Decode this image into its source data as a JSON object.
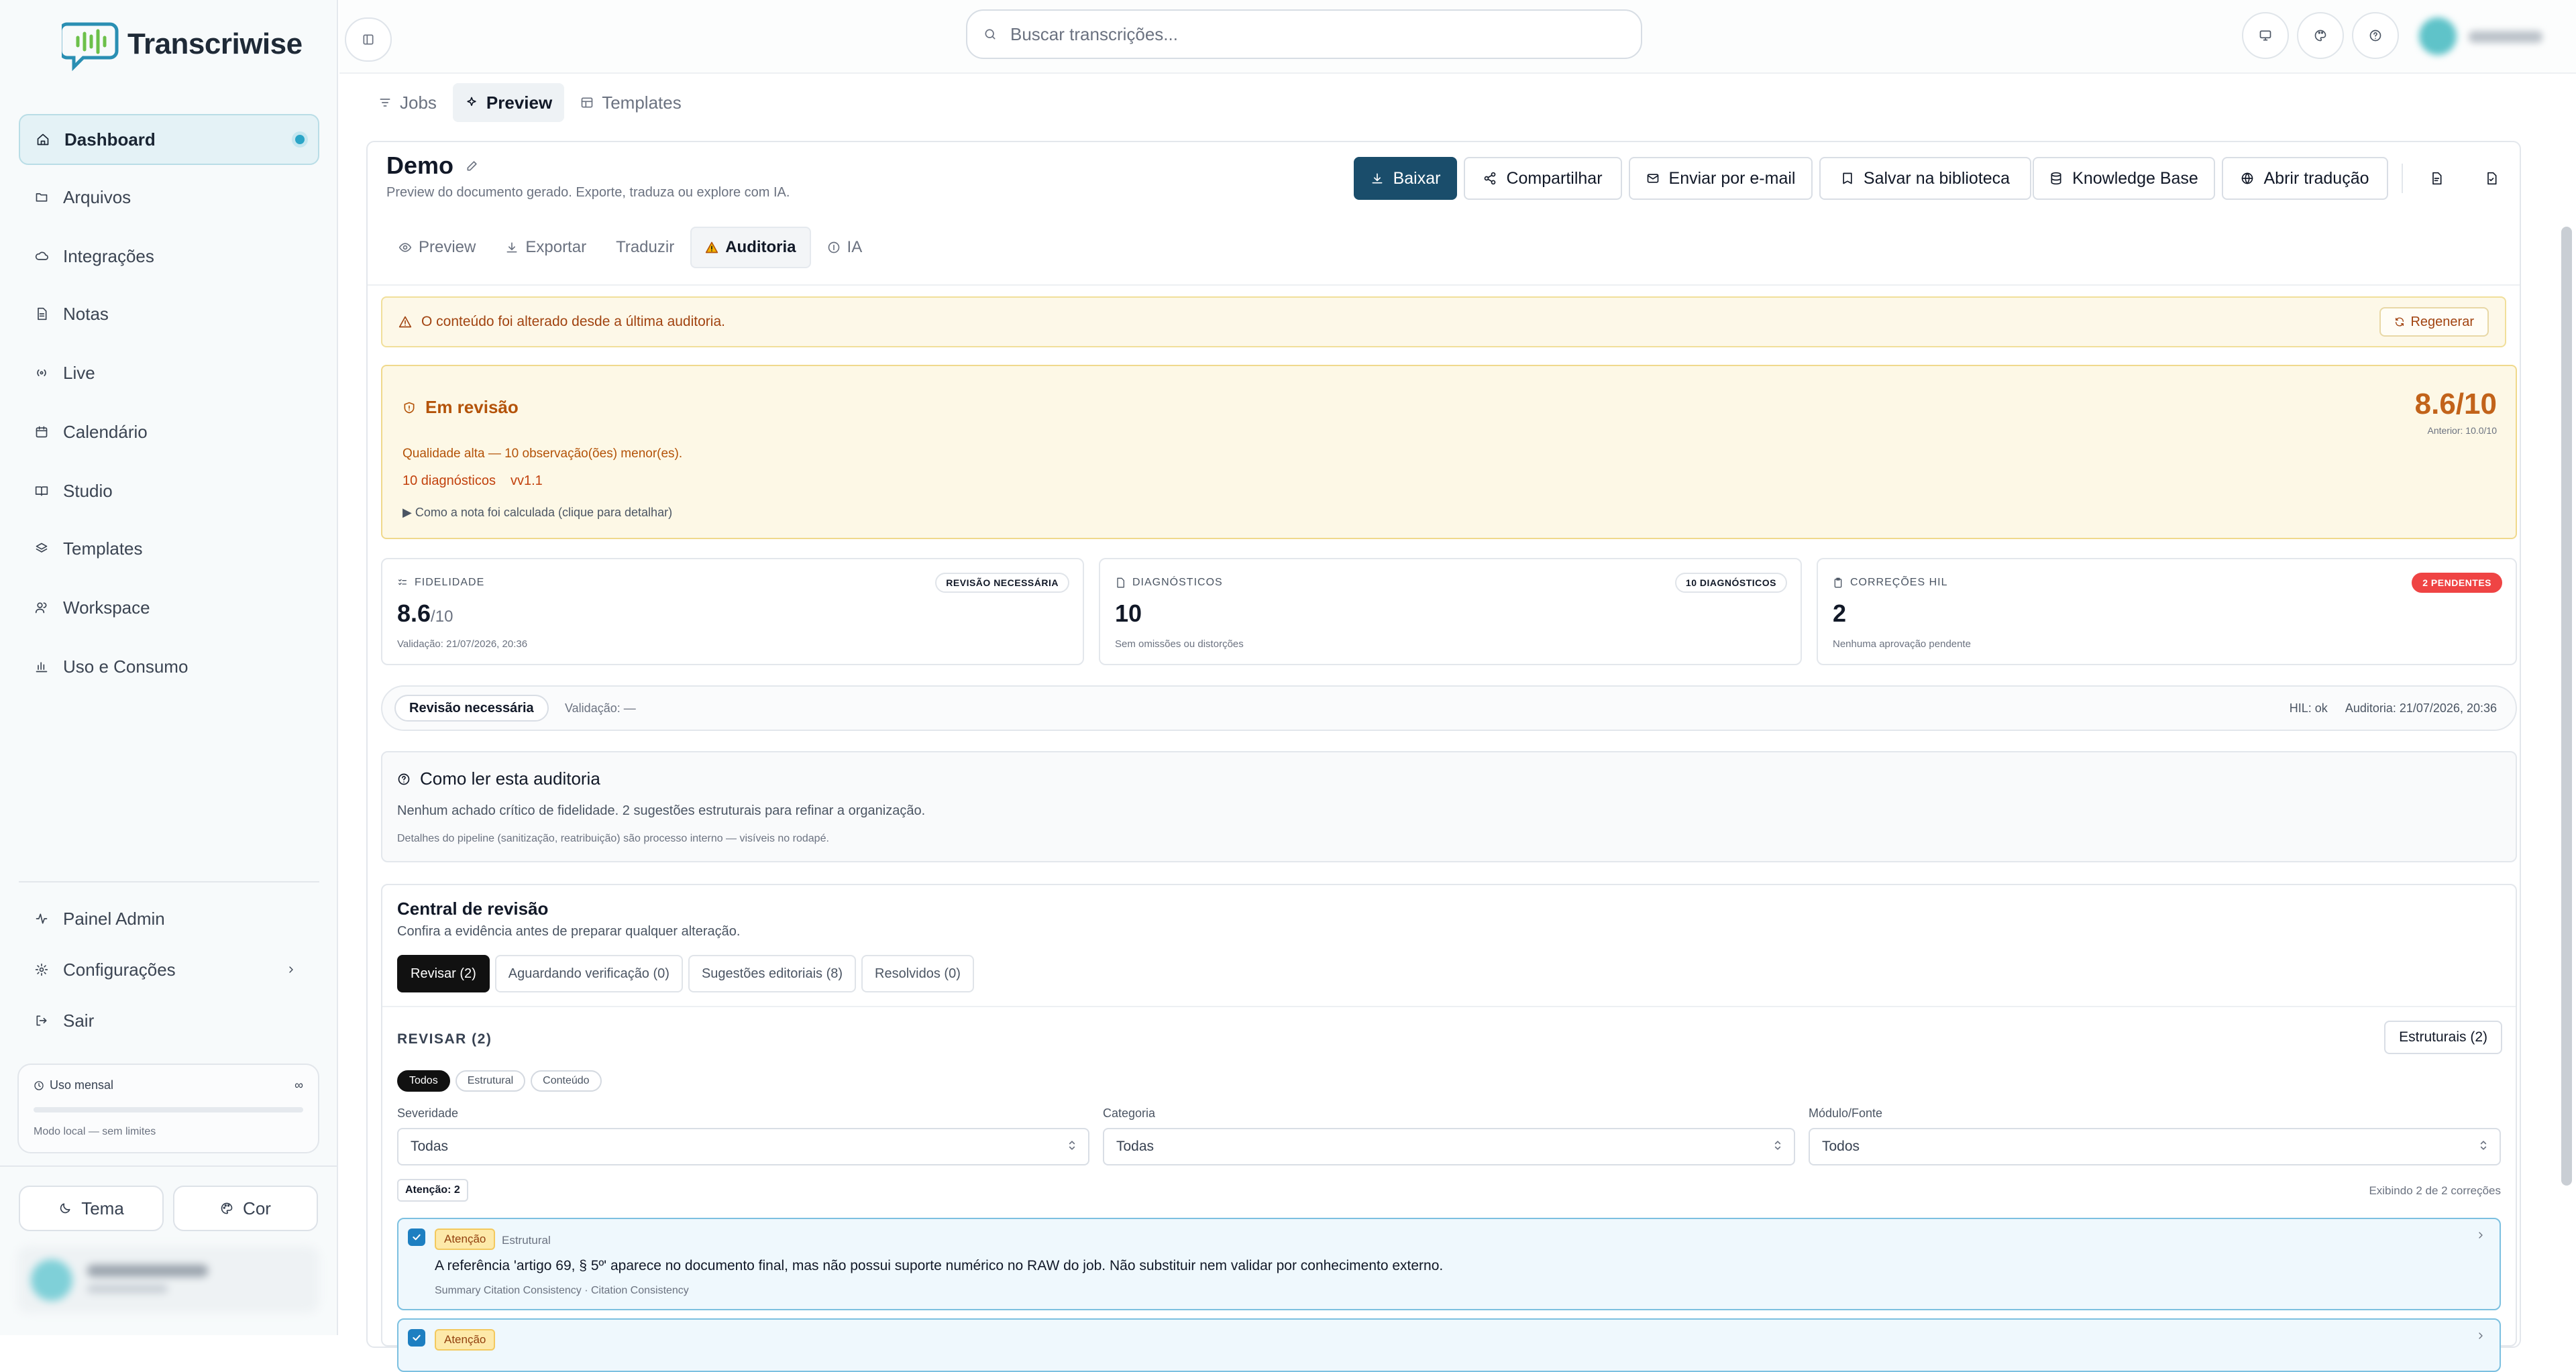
{
  "app": {
    "name": "Transcriwise"
  },
  "sidebar": {
    "items": [
      {
        "label": "Dashboard",
        "icon": "home-icon"
      },
      {
        "label": "Arquivos",
        "icon": "folder-icon"
      },
      {
        "label": "Integrações",
        "icon": "cloud-icon"
      },
      {
        "label": "Notas",
        "icon": "file-icon"
      },
      {
        "label": "Live",
        "icon": "broadcast-icon"
      },
      {
        "label": "Calendário",
        "icon": "calendar-icon"
      },
      {
        "label": "Studio",
        "icon": "book-icon"
      },
      {
        "label": "Templates",
        "icon": "layers-icon"
      },
      {
        "label": "Workspace",
        "icon": "users-icon"
      },
      {
        "label": "Uso e Consumo",
        "icon": "bar-chart-icon"
      }
    ],
    "bottom_items": [
      {
        "label": "Painel Admin",
        "icon": "activity-icon"
      },
      {
        "label": "Configurações",
        "icon": "gear-icon"
      },
      {
        "label": "Sair",
        "icon": "logout-icon"
      }
    ],
    "usage": {
      "title": "Uso mensal",
      "value": "∞",
      "note": "Modo local — sem limites"
    },
    "theme_label": "Tema",
    "color_label": "Cor"
  },
  "header": {
    "search_placeholder": "Buscar transcrições..."
  },
  "main_tabs": [
    {
      "label": "Jobs",
      "active": false
    },
    {
      "label": "Preview",
      "active": true
    },
    {
      "label": "Templates",
      "active": false
    }
  ],
  "doc": {
    "title": "Demo",
    "subtitle": "Preview do documento gerado. Exporte, traduza ou explore com IA.",
    "actions": {
      "download": "Baixar",
      "share": "Compartilhar",
      "email": "Enviar por e-mail",
      "library": "Salvar na biblioteca",
      "kb": "Knowledge Base",
      "translate": "Abrir tradução"
    }
  },
  "sub_tabs": [
    {
      "label": "Preview",
      "active": false
    },
    {
      "label": "Exportar",
      "active": false
    },
    {
      "label": "Traduzir",
      "active": false
    },
    {
      "label": "Auditoria",
      "active": true
    },
    {
      "label": "IA",
      "active": false
    }
  ],
  "warning": {
    "text": "O conteúdo foi alterado desde a última auditoria.",
    "button": "Regenerar"
  },
  "review": {
    "title": "Em revisão",
    "quality": "Qualidade alta — 10 observação(ões) menor(es).",
    "diagnostics": "10 diagnósticos",
    "version": "vv1.1",
    "calc": "▶ Como a nota foi calculada (clique para detalhar)",
    "score": "8.6/10",
    "previous": "Anterior: 10.0/10"
  },
  "metrics": [
    {
      "label": "FIDELIDADE",
      "badge": "REVISÃO NECESSÁRIA",
      "value": "8.6",
      "suffix": "/10",
      "sub": "Validação: 21/07/2026, 20:36"
    },
    {
      "label": "DIAGNÓSTICOS",
      "badge": "10 DIAGNÓSTICOS",
      "value": "10",
      "suffix": "",
      "sub": "Sem omissões ou distorções"
    },
    {
      "label": "CORREÇÕES HIL",
      "badge": "2 PENDENTES",
      "value": "2",
      "suffix": "",
      "sub": "Nenhuma aprovação pendente"
    }
  ],
  "status": {
    "pill": "Revisão necessária",
    "validation": "Validação: —",
    "hil": "HIL: ok",
    "audit": "Auditoria: 21/07/2026, 20:36"
  },
  "howto": {
    "title": "Como ler esta auditoria",
    "text": "Nenhum achado crítico de fidelidade. 2 sugestões estruturais para refinar a organização.",
    "note": "Detalhes do pipeline (sanitização, reatribuição) são processo interno — visíveis no rodapé."
  },
  "central": {
    "title": "Central de revisão",
    "subtitle": "Confira a evidência antes de preparar qualquer alteração.",
    "tabs": [
      {
        "label": "Revisar (2)",
        "active": true
      },
      {
        "label": "Aguardando verificação (0)",
        "active": false
      },
      {
        "label": "Sugestões editoriais (8)",
        "active": false
      },
      {
        "label": "Resolvidos (0)",
        "active": false
      }
    ],
    "section": "REVISAR (2)",
    "structural_button": "Estruturais (2)",
    "chips": [
      {
        "label": "Todos",
        "active": true
      },
      {
        "label": "Estrutural",
        "active": false
      },
      {
        "label": "Conteúdo",
        "active": false
      }
    ],
    "filters": [
      {
        "label": "Severidade",
        "value": "Todas"
      },
      {
        "label": "Categoria",
        "value": "Todas"
      },
      {
        "label": "Módulo/Fonte",
        "value": "Todos"
      }
    ],
    "attention": "Atenção: 2",
    "showing": "Exibindo 2 de 2 correções",
    "items": [
      {
        "tag": "Atenção",
        "category": "Estrutural",
        "text": "A referência 'artigo 69, § 5º' aparece no documento final, mas não possui suporte numérico no RAW do job. Não substituir nem validar por conhecimento externo.",
        "source": "Summary Citation Consistency · Citation Consistency"
      },
      {
        "tag": "Atenção",
        "category": "",
        "text": "",
        "source": ""
      }
    ]
  }
}
